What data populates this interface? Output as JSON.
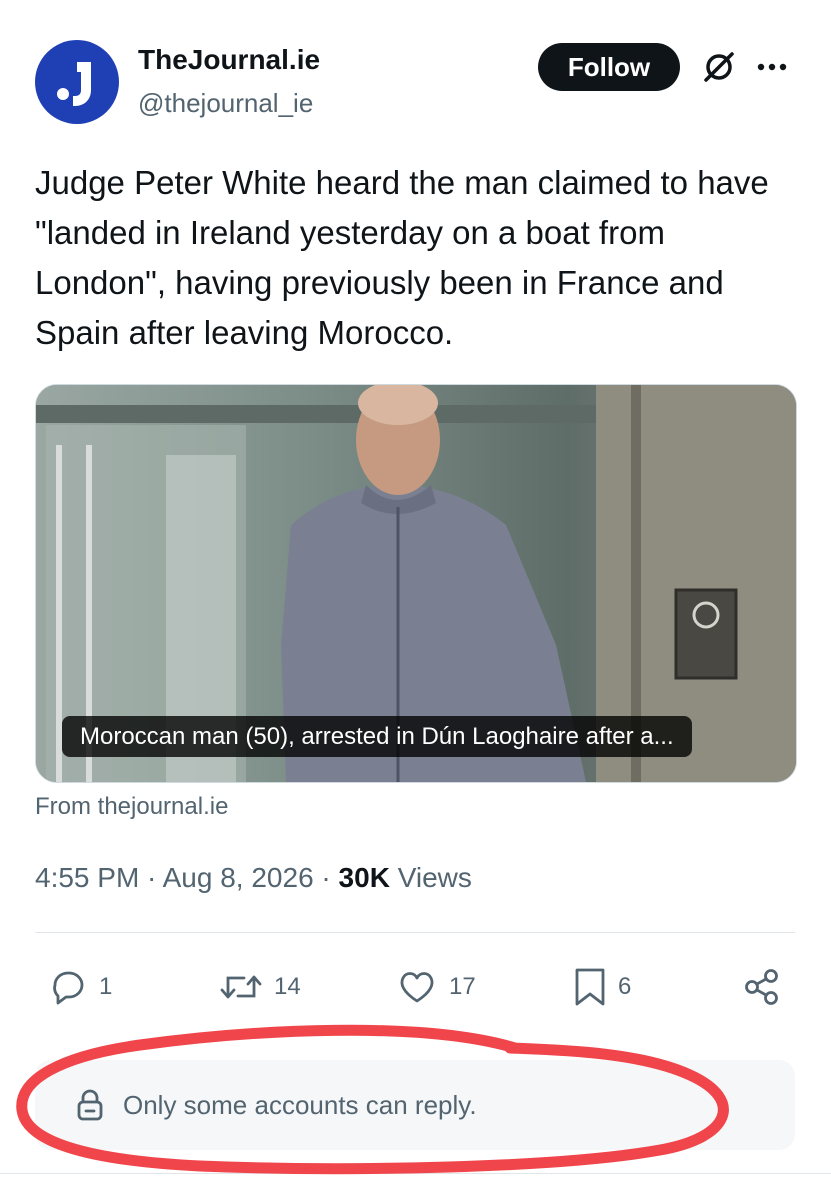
{
  "account": {
    "display_name": "TheJournal.ie",
    "handle": "@thejournal_ie",
    "avatar_letter": "J",
    "avatar_color": "#1f3fb5"
  },
  "header": {
    "follow_label": "Follow",
    "grok_icon": "grok-slash-icon",
    "more_icon": "more-dots-icon"
  },
  "tweet": {
    "text": "Judge Peter White heard the man claimed to have \"landed in Ireland yesterday on a boat from London\", having previously been in France and Spain after leaving Morocco."
  },
  "card": {
    "caption": "Moroccan man (50), arrested in Dún Laoghaire after a...",
    "source": "From thejournal.ie"
  },
  "meta": {
    "time": "4:55 PM",
    "date": "Aug 8, 2026",
    "views_count": "30K",
    "views_label": "Views"
  },
  "actions": {
    "replies": "1",
    "reposts": "14",
    "likes": "17",
    "bookmarks": "6"
  },
  "reply_restriction": {
    "text": "Only some accounts can reply."
  },
  "colors": {
    "annotation_red": "#f0464b",
    "text_primary": "#0f1419",
    "text_secondary": "#536471"
  }
}
